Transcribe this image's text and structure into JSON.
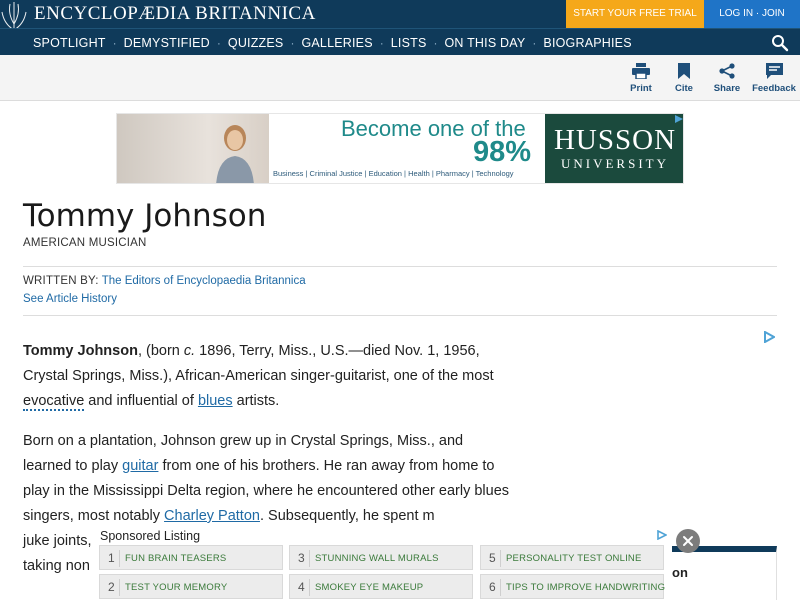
{
  "header": {
    "brand": "ENCYCLOPÆDIA BRITANNICA",
    "trial_label": "START YOUR FREE TRIAL",
    "login_label": "LOG IN · JOIN"
  },
  "nav": {
    "items": [
      "SPOTLIGHT",
      "DEMYSTIFIED",
      "QUIZZES",
      "GALLERIES",
      "LISTS",
      "ON THIS DAY",
      "BIOGRAPHIES"
    ],
    "separator": "·"
  },
  "toolbar": {
    "print": "Print",
    "cite": "Cite",
    "share": "Share",
    "feedback": "Feedback"
  },
  "ad": {
    "headline1": "Become one of the",
    "headline2": "98%",
    "tagline": "Business | Criminal Justice | Education | Health | Pharmacy | Technology",
    "logo_name": "HUSSON",
    "logo_sub": "UNIVERSITY"
  },
  "article": {
    "title": "Tommy Johnson",
    "subtitle": "AMERICAN MUSICIAN",
    "written_by_label": "WRITTEN BY:",
    "author": "The Editors of Encyclopaedia Britannica",
    "history_link": "See Article History",
    "p1": {
      "name": "Tommy Johnson",
      "t1": ", (born ",
      "circa": "c.",
      "t2": " 1896, Terry, Miss., U.S.—died Nov. 1, 1956, Crystal Springs, Miss.), African-American singer-guitarist, one of the most ",
      "link1": "evocative",
      "t3": " and influential of ",
      "link2": "blues",
      "t4": " artists."
    },
    "p2": {
      "t1": "Born on a plantation, Johnson grew up in Crystal Springs, Miss., and learned to play ",
      "link1": "guitar",
      "t2": " from one of his brothers. He ran away from home to play in the Mississippi Delta region, where he encountered other early blues singers, most notably ",
      "link2": "Charley Patton",
      "t3": ". Subsequently, he spent m",
      "t4": "juke joints,",
      "t5": "taking non"
    }
  },
  "sponsored": {
    "title": "Sponsored Listing",
    "items": [
      {
        "num": "1",
        "text": "FUN BRAIN TEASERS"
      },
      {
        "num": "3",
        "text": "STUNNING WALL MURALS"
      },
      {
        "num": "5",
        "text": "PERSONALITY TEST ONLINE"
      },
      {
        "num": "2",
        "text": "TEST YOUR MEMORY"
      },
      {
        "num": "4",
        "text": "SMOKEY EYE MAKEUP"
      },
      {
        "num": "6",
        "text": "TIPS TO IMPROVE HANDWRITING"
      }
    ],
    "side_text": "on"
  },
  "colors": {
    "header_bg": "#0f3a5a",
    "trial_bg": "#f5a81a",
    "login_bg": "#1f74c7",
    "link": "#1f6aa5",
    "ad_teal": "#1f8a8a",
    "ad_logo_bg": "#1b4a3d"
  },
  "icons": [
    "thistle-logo-icon",
    "search-icon",
    "print-icon",
    "bookmark-icon",
    "share-icon",
    "feedback-icon",
    "adchoices-icon",
    "close-icon"
  ]
}
